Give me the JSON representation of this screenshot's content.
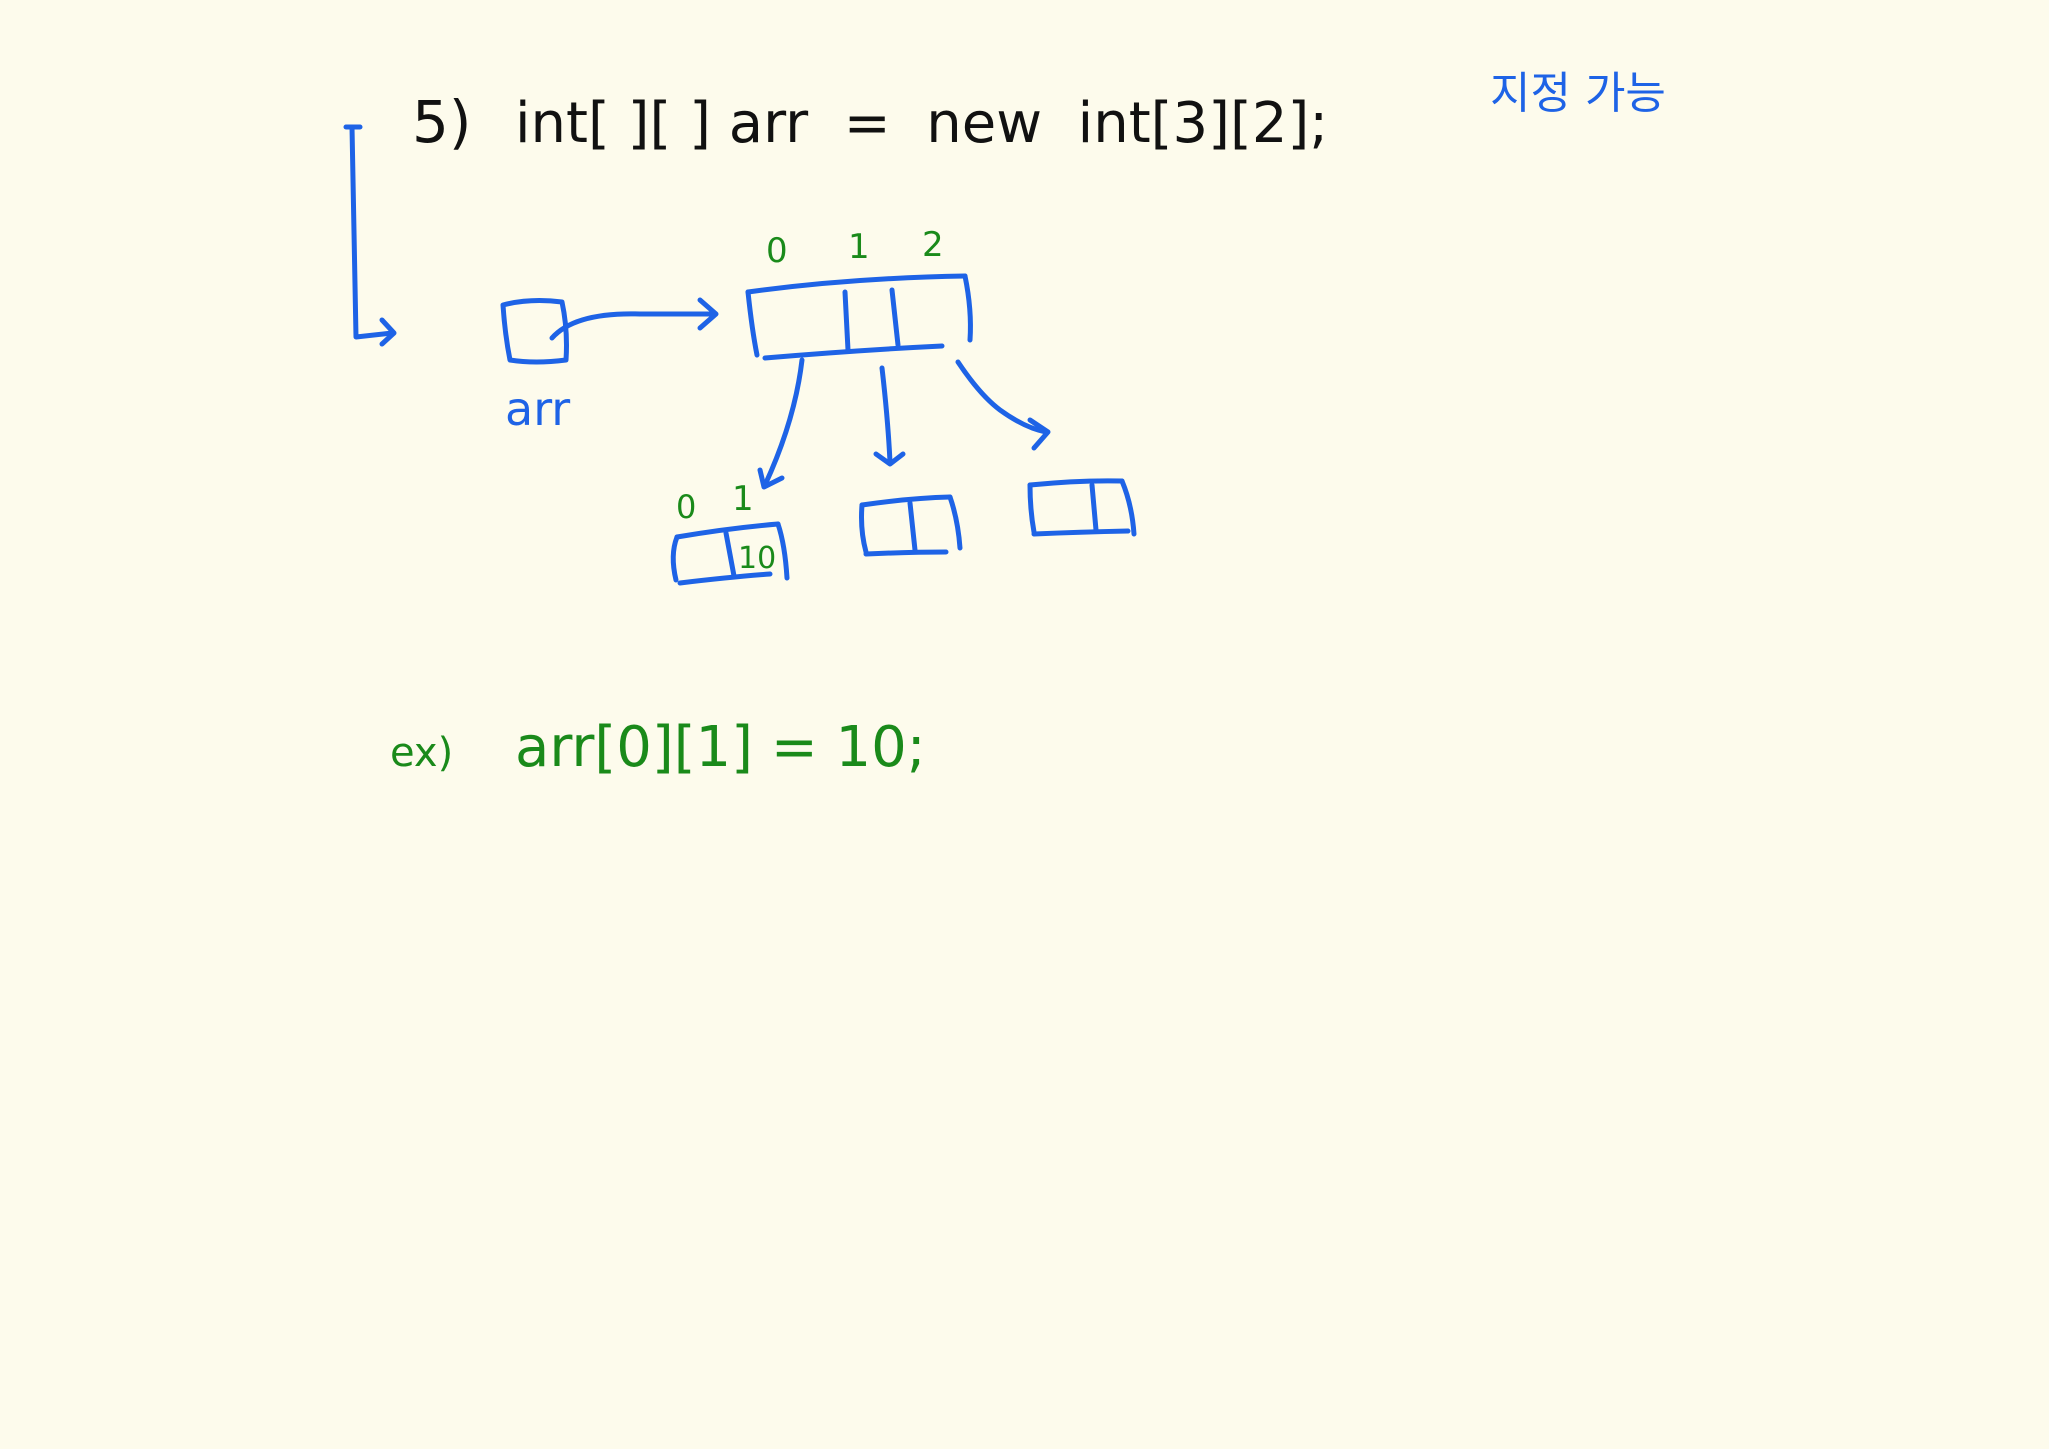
{
  "colors": {
    "background": "#fdfbec",
    "code": "#111111",
    "annotation": "#1e63e6",
    "index": "#1a8a1a"
  },
  "heading": {
    "number": "5)",
    "code": "int[ ][ ] arr  =  new  int[3][2];",
    "note": "지정 가능"
  },
  "diagram": {
    "variable_label": "arr",
    "outer_indices": [
      "0",
      "1",
      "2"
    ],
    "inner_indices": [
      "0",
      "1"
    ],
    "inner_value": "10"
  },
  "example": {
    "prefix": "ex)",
    "code": "arr[0][1] = 10;"
  }
}
